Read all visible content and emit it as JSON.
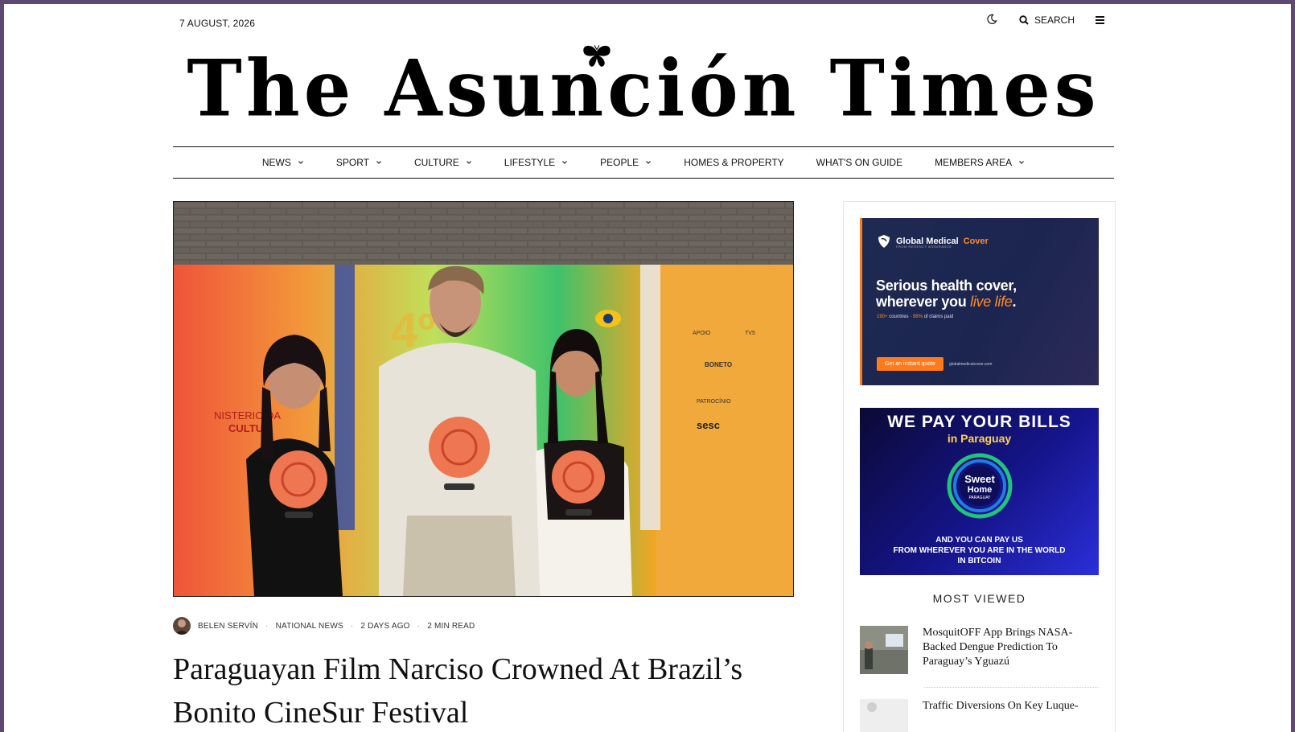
{
  "topbar": {
    "date": "7 AUGUST, 2026",
    "search_label": "SEARCH",
    "icons": {
      "theme": "moon-icon",
      "search": "search-icon",
      "menu": "hamburger-icon"
    }
  },
  "masthead": {
    "title": "The Asunción Times",
    "logo_ornament": "butterfly-icon"
  },
  "nav": {
    "items": [
      {
        "label": "NEWS",
        "dropdown": true
      },
      {
        "label": "SPORT",
        "dropdown": true
      },
      {
        "label": "CULTURE",
        "dropdown": true
      },
      {
        "label": "LIFESTYLE",
        "dropdown": true
      },
      {
        "label": "PEOPLE",
        "dropdown": true
      },
      {
        "label": "HOMES & PROPERTY",
        "dropdown": false
      },
      {
        "label": "WHAT'S ON GUIDE",
        "dropdown": false
      },
      {
        "label": "MEMBERS AREA",
        "dropdown": true
      }
    ]
  },
  "article": {
    "author": "BELEN SERVÍN",
    "category": "NATIONAL NEWS",
    "time_ago": "2 DAYS AGO",
    "read_time": "2 MIN READ",
    "headline": "Paraguayan Film Narciso Crowned At Brazil’s Bonito CineSur Festival",
    "image_backdrop": {
      "number": "4º",
      "left_text_1": "NISTERIO DA",
      "left_text_2": "CULTU",
      "right_labels": [
        "APOIO",
        "TV5",
        "BONETO",
        "PATROCÍNIO",
        "sesc"
      ]
    }
  },
  "sidebar": {
    "ad1": {
      "brand": "Global Medical",
      "brand_accent": "Cover",
      "brand_sub": "FROM REGENCY ASSURANCE",
      "headline_line1": "Serious health cover,",
      "headline_line2": "wherever you",
      "headline_accent": "live life",
      "headline_end": ".",
      "stat1_value": "190+",
      "stat1_label": "countries",
      "stat2_value": "98%",
      "stat2_label": "of claims paid",
      "cta": "Get an instant quote",
      "url": "globalmedicalcover.com"
    },
    "ad2": {
      "title": "WE PAY YOUR BILLS",
      "subtitle": "in Paraguay",
      "logo_line1": "Sweet",
      "logo_line2": "Home",
      "logo_line3": "PARAGUAY",
      "footer_line1": "AND YOU CAN PAY US",
      "footer_line2": "FROM WHEREVER YOU ARE IN THE WORLD",
      "footer_line3": "IN BITCOIN"
    },
    "most_viewed": {
      "title": "MOST VIEWED",
      "items": [
        {
          "title": "MosquitOFF App Brings NASA-Backed Dengue Prediction To Paraguay’s Yguazú"
        },
        {
          "title": "Traffic Diversions On Key Luque-"
        }
      ]
    }
  }
}
